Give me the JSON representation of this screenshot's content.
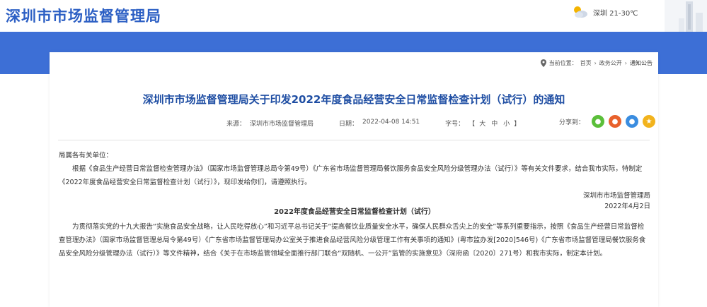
{
  "header": {
    "site_title": "深圳市市场监督管理局",
    "weather_text": "深圳 21-30℃"
  },
  "breadcrumb": {
    "items": [
      "当前位置：",
      "首页",
      "政务公开",
      "通知公告"
    ]
  },
  "article": {
    "title": "深圳市市场监督管理局关于印发2022年度食品经营安全日常监督检查计划（试行）的通知",
    "meta": {
      "source_label": "来源：",
      "source": "深圳市市场监督管理局",
      "date_label": "日期：",
      "date": "2022-04-08 14:51",
      "font_label": "字号：",
      "font_large": "大",
      "font_medium": "中",
      "font_small": "小"
    },
    "share_label": "分享到：",
    "salutation": "局属各有关单位：",
    "paragraph1": "根据《食品生产经营日常监督检查管理办法》（国家市场监督管理总局令第49号）《广东省市场监督管理局餐饮服务食品安全风险分级管理办法（试行）》等有关文件要求，结合我市实际，特制定《2022年度食品经营安全日常监督检查计划（试行）》，现印发给你们，请遵照执行。",
    "signature_org": "深圳市市场监督管理局",
    "signature_date": "2022年4月2日",
    "plan_title": "2022年度食品经营安全日常监督检查计划（试行）",
    "paragraph2": "为贯彻落实党的十九大报告“实施食品安全战略，让人民吃得放心”和习近平总书记关于“提高餐饮业质量安全水平，确保人民群众舌尖上的安全”等系列重要指示，按照《食品生产经营日常监督检查管理办法》（国家市场监督管理总局令第49号）《广东省市场监督管理局办公室关于推进食品经营风险分级管理工作有关事项的通知》(粤市监办发[2020]546号)《广东省市场监督管理局餐饮服务食品安全风险分级管理办法（试行）》等文件精神，结合《关于在市场监管领域全面推行部门联合“双随机、一公开”监管的实施意见》（深府函〔2020〕271号）和我市实际，制定本计划。"
  },
  "colors": {
    "brand_blue": "#2c5fc4",
    "band_blue": "#3d6fd6",
    "title_blue": "#1f4ea3"
  }
}
